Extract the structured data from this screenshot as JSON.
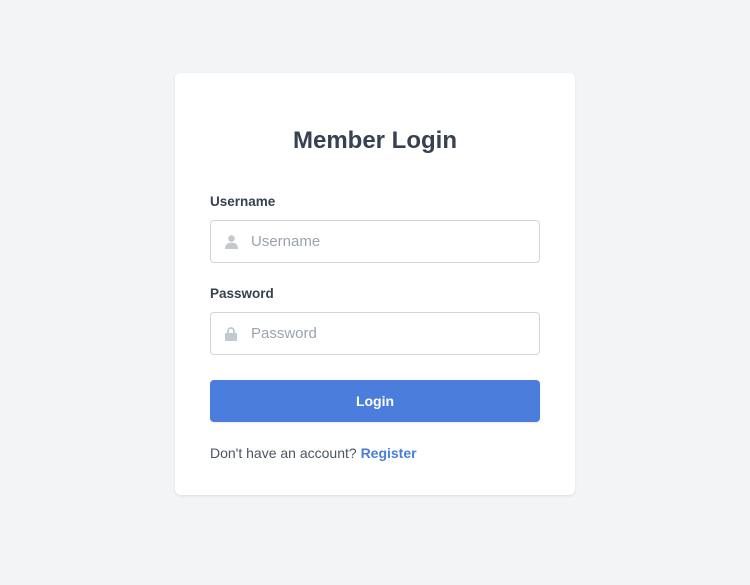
{
  "login": {
    "title": "Member Login",
    "username": {
      "label": "Username",
      "placeholder": "Username",
      "value": "",
      "icon": "user-icon"
    },
    "password": {
      "label": "Password",
      "placeholder": "Password",
      "value": "",
      "icon": "lock-icon"
    },
    "submit_label": "Login",
    "footer": {
      "prompt": "Don't have an account? ",
      "link_label": "Register"
    }
  },
  "colors": {
    "background": "#f3f4f6",
    "card": "#ffffff",
    "accent": "#4a7ddc",
    "text": "#374151",
    "placeholder": "#9ca3af",
    "border": "#d1d5db"
  }
}
